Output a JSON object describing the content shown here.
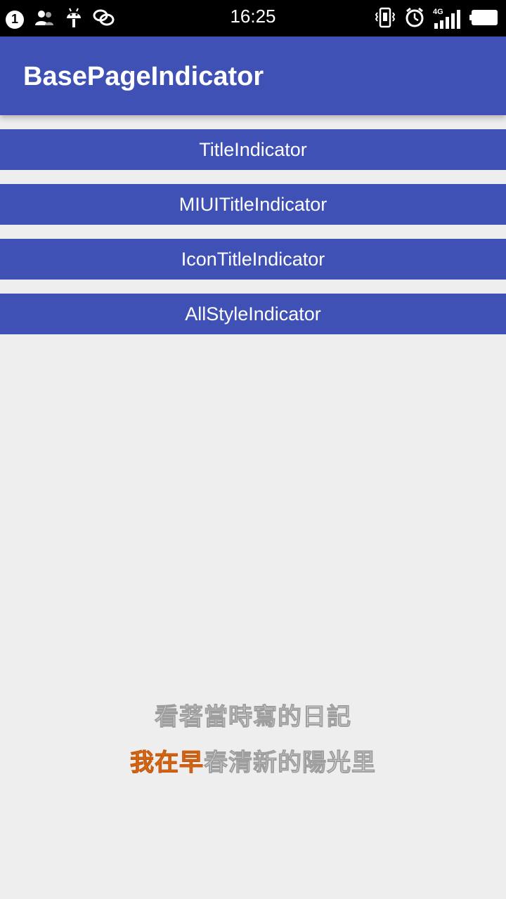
{
  "status_bar": {
    "notification_count": "1",
    "time": "16:25",
    "network_label": "4G",
    "icons_left": [
      "notification-count-icon",
      "contacts-icon",
      "android-debug-icon",
      "link-icon"
    ],
    "icons_right": [
      "vibrate-icon",
      "alarm-icon",
      "signal-4g-icon",
      "battery-icon"
    ]
  },
  "app_bar": {
    "title": "BasePageIndicator",
    "color": "#3f51b5"
  },
  "menu": {
    "items": [
      {
        "label": "TitleIndicator"
      },
      {
        "label": "MIUITitleIndicator"
      },
      {
        "label": "IconTitleIndicator"
      },
      {
        "label": "AllStyleIndicator"
      }
    ]
  },
  "lyrics": {
    "line1": "看著當時寫的日記",
    "line2_sung": "我在早",
    "line2_rest": "春清新的陽光里",
    "highlight_color": "#f07a1e"
  }
}
